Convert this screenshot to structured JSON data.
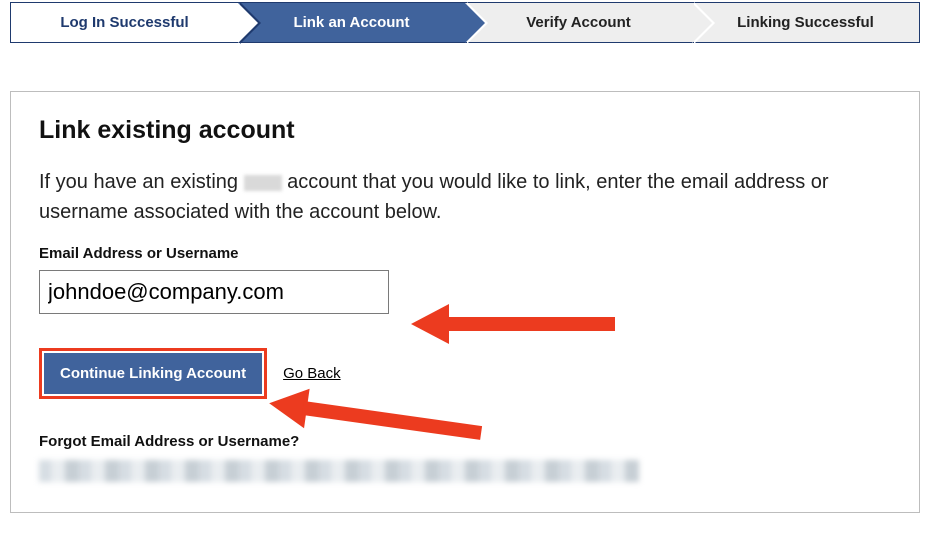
{
  "progress": {
    "step1": "Log In Successful",
    "step2": "Link an Account",
    "step3": "Verify Account",
    "step4": "Linking Successful"
  },
  "panel": {
    "title": "Link existing account",
    "intro_pre": "If you have an existing ",
    "intro_post": " account that you would like to link, enter the email address or username associated with the account below.",
    "field_label": "Email Address or Username",
    "email_value": "johndoe@company.com",
    "continue_label": "Continue Linking Account",
    "go_back_label": "Go Back",
    "forgot_label": "Forgot Email Address or Username?"
  }
}
